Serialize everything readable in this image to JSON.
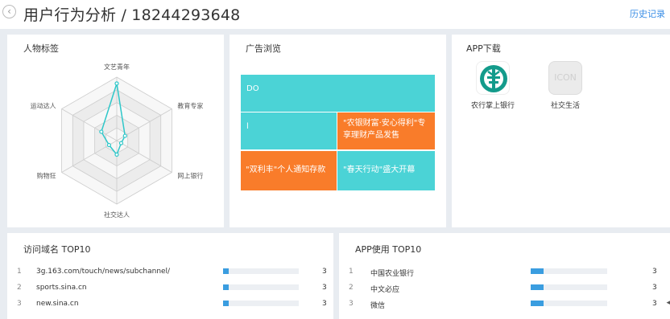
{
  "header": {
    "back_glyph": "‹",
    "title": "用户行为分析 / 18244293648",
    "history_link": "历史记录"
  },
  "persona": {
    "title": "人物标签",
    "axes": [
      "文艺青年",
      "教育专家",
      "网上银行",
      "社交达人",
      "购物狂",
      "运动达人"
    ],
    "values": [
      0.9,
      0.15,
      0.08,
      0.22,
      0.14,
      0.28
    ],
    "max": 1,
    "line_color": "#2ec7c9",
    "ring_fill_dark": "#ececec",
    "ring_fill_light": "#f7f7f7"
  },
  "ads": {
    "title": "广告浏览",
    "tiles": [
      {
        "label": "DO",
        "color": "#4bd3d6"
      },
      {
        "label": "l",
        "color": "#4bd3d6"
      },
      {
        "label": "\"农银财富·安心得利\"专享理财产品发售",
        "color": "#f97c2a"
      },
      {
        "label": "\"双利丰\"个人通知存款",
        "color": "#f97c2a"
      },
      {
        "label": "\"春天行动\"盛大开幕",
        "color": "#4bd3d6"
      }
    ]
  },
  "apps": {
    "title": "APP下载",
    "items": [
      {
        "name": "农行掌上银行",
        "icon": "abc-bank-logo-icon"
      },
      {
        "name": "社交生活",
        "icon_text": "ICON"
      }
    ]
  },
  "domains": {
    "title": "访问域名 TOP10",
    "max": 40,
    "rows": [
      {
        "rank": "1",
        "name": "3g.163.com/touch/news/subchannel/",
        "count": 3
      },
      {
        "rank": "2",
        "name": "sports.sina.cn",
        "count": 3
      },
      {
        "rank": "3",
        "name": "new.sina.cn",
        "count": 3
      }
    ]
  },
  "app_usage": {
    "title": "APP使用 TOP10",
    "max": 18,
    "rows": [
      {
        "rank": "1",
        "name": "中国农业银行",
        "count": 3
      },
      {
        "rank": "2",
        "name": "中文必应",
        "count": 3
      },
      {
        "rank": "3",
        "name": "微信",
        "count": 3
      }
    ]
  },
  "side_arrow": "◂"
}
